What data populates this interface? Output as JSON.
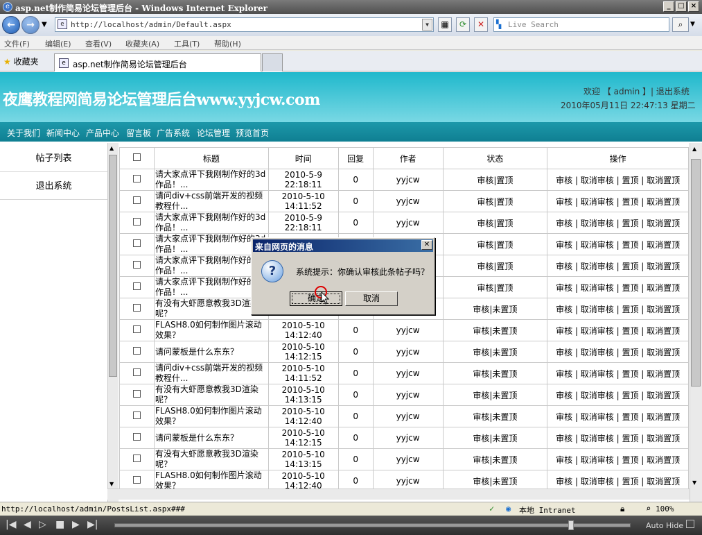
{
  "window": {
    "title": "asp.net制作简易论坛管理后台 - Windows Internet Explorer",
    "ie_icon": "e"
  },
  "browser": {
    "url": "http://localhost/admin/Default.aspx",
    "search_placeholder": "Live Search",
    "menu": [
      "文件(F)",
      "编辑(E)",
      "查看(V)",
      "收藏夹(A)",
      "工具(T)",
      "帮助(H)"
    ],
    "favorites_label": "收藏夹",
    "tab_title": "asp.net制作简易论坛管理后台"
  },
  "header": {
    "site_title": "夜鹰教程网简易论坛管理后台www.yyjcw.com",
    "welcome": "欢迎 【 admin 】| 退出系统",
    "datetime": "2010年05月11日 22:47:13 星期二"
  },
  "nav": [
    "关于我们",
    "新闻中心",
    "产品中心",
    "留言板",
    "广告系统",
    "论坛管理",
    "预览首页"
  ],
  "sidebar": [
    "帖子列表",
    "退出系统"
  ],
  "table": {
    "headers": [
      "标题",
      "时间",
      "回复",
      "作者",
      "状态",
      "操作"
    ],
    "rows": [
      {
        "title": "请大家点评下我刚制作好的3d作品！...",
        "time": "2010-5-9 22:18:11",
        "replies": "0",
        "author": "yyjcw",
        "status": "审核|置顶",
        "actions": "审核 | 取消审核 | 置顶 | 取消置顶"
      },
      {
        "title": "请问div+css前端开发的视频教程什...",
        "time": "2010-5-10 14:11:52",
        "replies": "0",
        "author": "yyjcw",
        "status": "审核|置顶",
        "actions": "审核 | 取消审核 | 置顶 | 取消置顶"
      },
      {
        "title": "请大家点评下我刚制作好的3d作品！...",
        "time": "2010-5-9 22:18:11",
        "replies": "0",
        "author": "yyjcw",
        "status": "审核|置顶",
        "actions": "审核 | 取消审核 | 置顶 | 取消置顶"
      },
      {
        "title": "请大家点评下我刚制作好的3d作品！...",
        "time": "",
        "replies": "",
        "author": "",
        "status": "审核|置顶",
        "actions": "审核 | 取消审核 | 置顶 | 取消置顶"
      },
      {
        "title": "请大家点评下我刚制作好的3d作品！...",
        "time": "",
        "replies": "",
        "author": "",
        "status": "审核|置顶",
        "actions": "审核 | 取消审核 | 置顶 | 取消置顶"
      },
      {
        "title": "请大家点评下我刚制作好的3d作品！...",
        "time": "",
        "replies": "",
        "author": "",
        "status": "审核|置顶",
        "actions": "审核 | 取消审核 | 置顶 | 取消置顶"
      },
      {
        "title": "有没有大虾愿意教我3D渲染呢？",
        "time": "",
        "replies": "",
        "author": "",
        "status": "审核|未置顶",
        "actions": "审核 | 取消审核 | 置顶 | 取消置顶"
      },
      {
        "title": "FLASH8.0如何制作图片滚动效果？",
        "time": "2010-5-10 14:12:40",
        "replies": "0",
        "author": "yyjcw",
        "status": "审核|未置顶",
        "actions": "审核 | 取消审核 | 置顶 | 取消置顶"
      },
      {
        "title": "请问蒙板是什么东东？",
        "time": "2010-5-10 14:12:15",
        "replies": "0",
        "author": "yyjcw",
        "status": "审核|未置顶",
        "actions": "审核 | 取消审核 | 置顶 | 取消置顶"
      },
      {
        "title": "请问div+css前端开发的视频教程什...",
        "time": "2010-5-10 14:11:52",
        "replies": "0",
        "author": "yyjcw",
        "status": "审核|未置顶",
        "actions": "审核 | 取消审核 | 置顶 | 取消置顶"
      },
      {
        "title": "有没有大虾愿意教我3D渲染呢？",
        "time": "2010-5-10 14:13:15",
        "replies": "0",
        "author": "yyjcw",
        "status": "审核|未置顶",
        "actions": "审核 | 取消审核 | 置顶 | 取消置顶"
      },
      {
        "title": "FLASH8.0如何制作图片滚动效果？",
        "time": "2010-5-10 14:12:40",
        "replies": "0",
        "author": "yyjcw",
        "status": "审核|未置顶",
        "actions": "审核 | 取消审核 | 置顶 | 取消置顶"
      },
      {
        "title": "请问蒙板是什么东东？",
        "time": "2010-5-10 14:12:15",
        "replies": "0",
        "author": "yyjcw",
        "status": "审核|未置顶",
        "actions": "审核 | 取消审核 | 置顶 | 取消置顶"
      },
      {
        "title": "有没有大虾愿意教我3D渲染呢？",
        "time": "2010-5-10 14:13:15",
        "replies": "0",
        "author": "yyjcw",
        "status": "审核|未置顶",
        "actions": "审核 | 取消审核 | 置顶 | 取消置顶"
      },
      {
        "title": "FLASH8.0如何制作图片滚动效果？",
        "time": "2010-5-10 14:12:40",
        "replies": "0",
        "author": "yyjcw",
        "status": "审核|未置顶",
        "actions": "审核 | 取消审核 | 置顶 | 取消置顶"
      }
    ]
  },
  "dialog": {
    "title": "来自网页的消息",
    "message": "系统提示：你确认审核此条帖子吗？",
    "ok": "确定",
    "cancel": "取消",
    "icon": "question-icon"
  },
  "statusbar": {
    "url": "http://localhost/admin/PostsList.aspx###",
    "zone": "本地 Intranet",
    "zoom": "100%"
  },
  "taskbar": {
    "autohide": "Auto Hide"
  },
  "colors": {
    "banner": "#1fb8cc",
    "nav": "#1098aa",
    "dialog_title": "#0a246a"
  }
}
